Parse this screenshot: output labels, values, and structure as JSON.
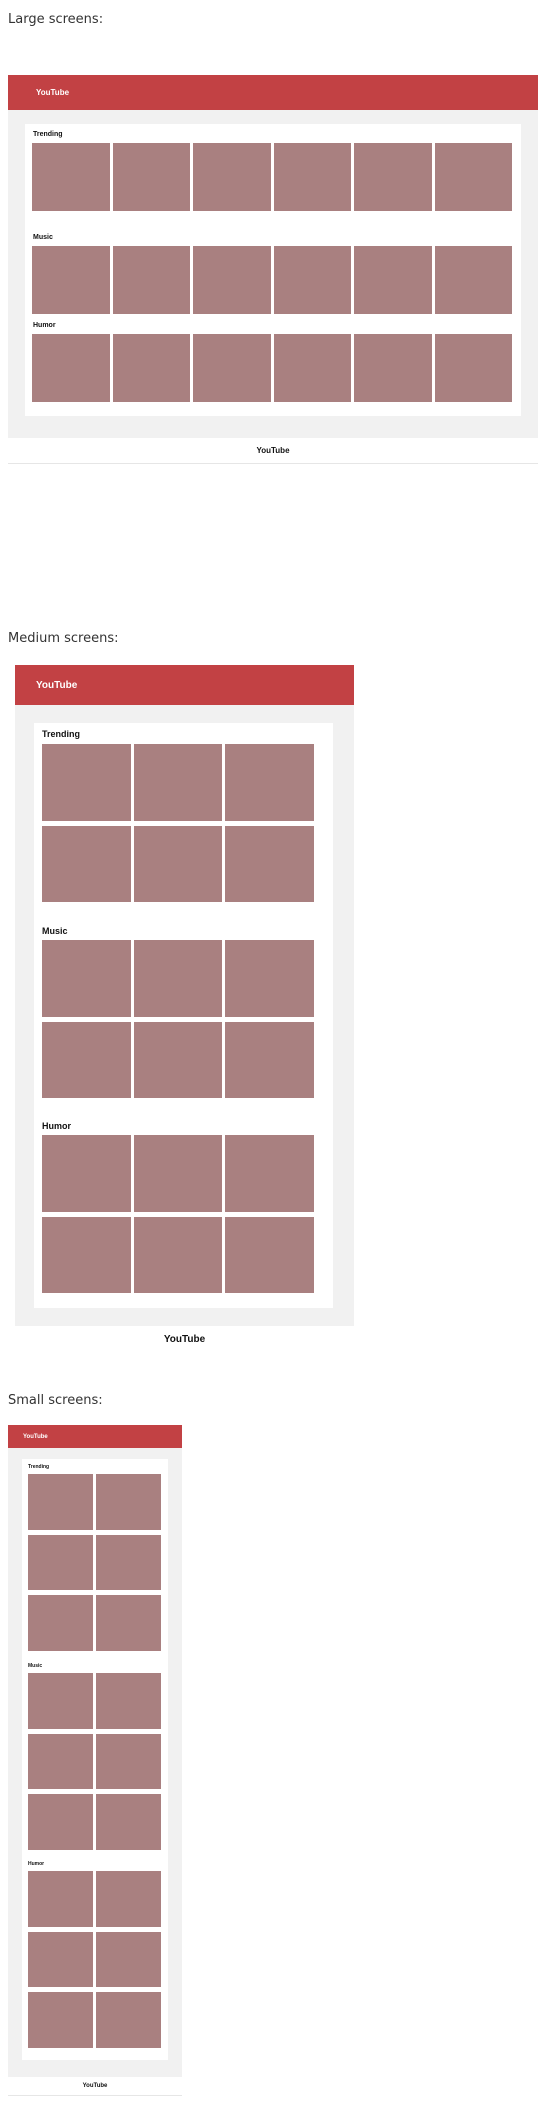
{
  "large": {
    "caption": "Large screens:",
    "header_title": "YouTube",
    "footer_label": "YouTube",
    "sections": [
      {
        "title": "Trending"
      },
      {
        "title": "Music"
      },
      {
        "title": "Humor"
      }
    ]
  },
  "medium": {
    "caption": "Medium screens:",
    "header_title": "YouTube",
    "footer_label": "YouTube",
    "sections": [
      {
        "title": "Trending"
      },
      {
        "title": "Music"
      },
      {
        "title": "Humor"
      }
    ]
  },
  "small": {
    "caption": "Small screens:",
    "header_title": "YouTube",
    "footer_label": "YouTube",
    "sections": [
      {
        "title": "Trending"
      },
      {
        "title": "Music"
      },
      {
        "title": "Humor"
      }
    ]
  },
  "colors": {
    "header_red": "#c24144",
    "thumbnail_mauve": "#a98080",
    "frame_gray": "#f1f1f1",
    "card_white": "#ffffff"
  }
}
